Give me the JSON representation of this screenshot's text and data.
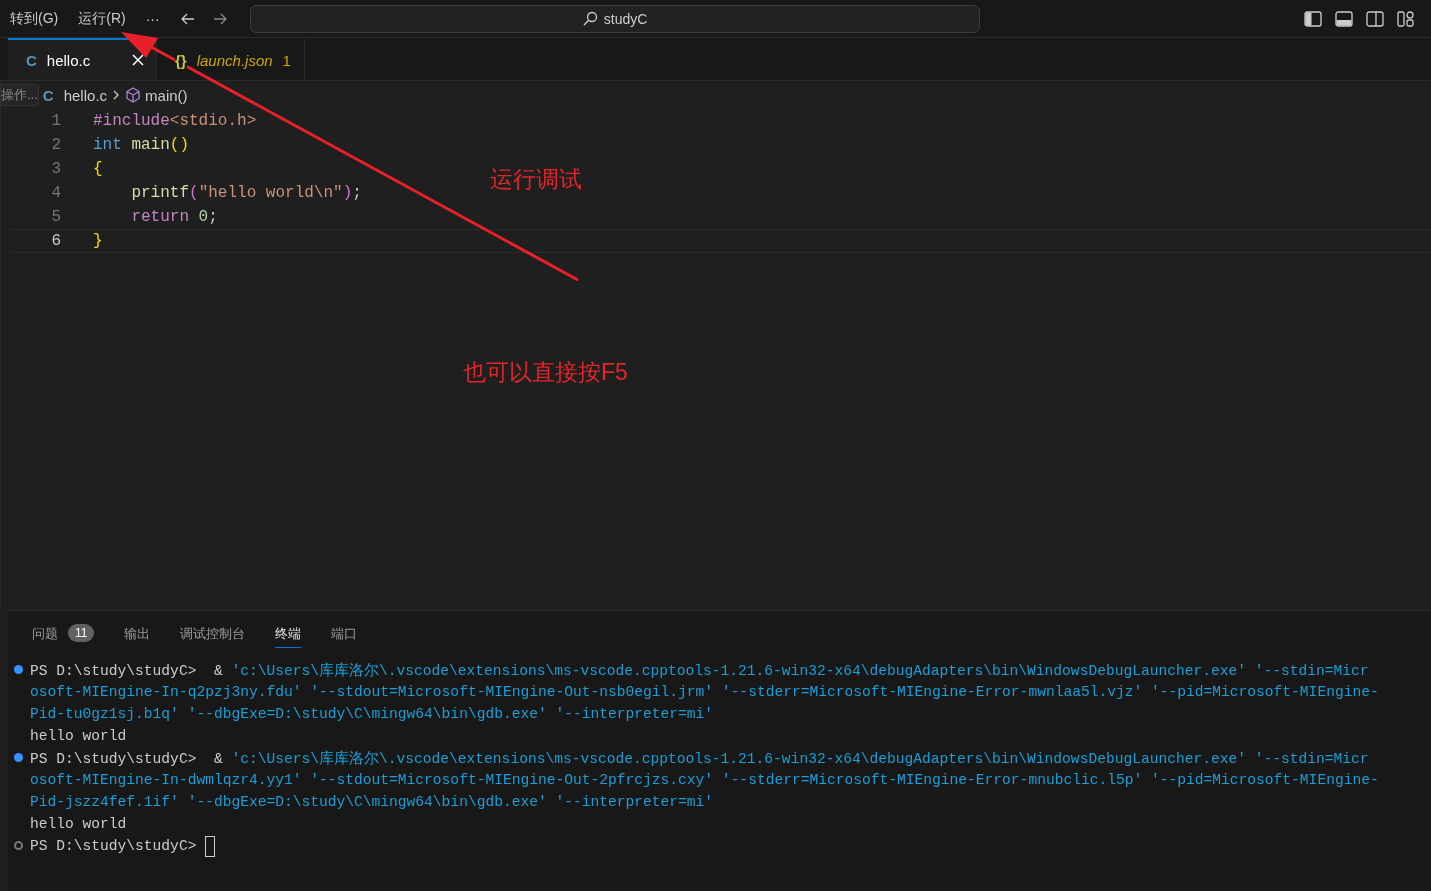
{
  "menu": [
    {
      "label": "转到(G)"
    },
    {
      "label": "运行(R)"
    },
    {
      "label": "···"
    }
  ],
  "search": {
    "value": "studyC"
  },
  "tabs": [
    {
      "icon": "C",
      "kind": "c",
      "label": "hello.c",
      "selected": true
    },
    {
      "icon": "{}",
      "kind": "json",
      "label": "launch.json",
      "count": "1",
      "selected": false
    }
  ],
  "breadcrumb": {
    "hover_hint": "操作...",
    "file_icon": "C",
    "file": "hello.c",
    "symbol": "main()"
  },
  "code": [
    {
      "number": "1",
      "current": false,
      "indent": false,
      "tokens": [
        {
          "kind": "directive",
          "text": "#include"
        },
        {
          "kind": "string",
          "text": "<stdio.h>"
        }
      ]
    },
    {
      "number": "2",
      "current": false,
      "indent": false,
      "tokens": [
        {
          "kind": "keyword",
          "text": "int"
        },
        {
          "kind": "function",
          "text": "main",
          "gap_before": true
        },
        {
          "kind": "bracket",
          "text": "()"
        }
      ]
    },
    {
      "number": "3",
      "current": false,
      "indent": false,
      "tokens": [
        {
          "kind": "bracket",
          "text": "{"
        }
      ]
    },
    {
      "number": "4",
      "current": false,
      "indent": true,
      "tokens": [
        {
          "kind": "function",
          "text": "printf"
        },
        {
          "kind": "bracket2",
          "text": "("
        },
        {
          "kind": "string",
          "text": "\"hello world\\n\""
        },
        {
          "kind": "bracket2",
          "text": ")"
        },
        {
          "kind": "plain",
          "text": ";"
        }
      ]
    },
    {
      "number": "5",
      "current": false,
      "indent": true,
      "tokens": [
        {
          "kind": "directive",
          "text": "return"
        },
        {
          "kind": "number",
          "text": "0",
          "gap_before": true
        },
        {
          "kind": "plain",
          "text": ";"
        }
      ]
    },
    {
      "number": "6",
      "current": true,
      "indent": false,
      "tokens": [
        {
          "kind": "bracket",
          "text": "}"
        }
      ]
    }
  ],
  "annotations": [
    {
      "text": "运行调试"
    },
    {
      "text": "也可以直接按F5"
    }
  ],
  "panel_tabs": [
    {
      "label": "问题",
      "badge": "11",
      "selected": false
    },
    {
      "label": "输出",
      "selected": false
    },
    {
      "label": "调试控制台",
      "selected": false
    },
    {
      "label": "终端",
      "selected": true
    },
    {
      "label": "端口",
      "selected": false
    }
  ],
  "terminal": [
    {
      "success": true,
      "lines": [
        [
          {
            "kind": "prompt",
            "text": "PS D:\\study\\studyC>  & "
          },
          {
            "kind": "arg",
            "text": "'c:\\Users\\库库洛尔\\.vscode\\extensions\\ms-vscode.cpptools-1.21.6-win32-x64\\debugAdapters\\bin\\WindowsDebugLauncher.exe' '--stdin=Micr"
          }
        ],
        [
          {
            "kind": "arg",
            "text": "osoft-MIEngine-In-q2pzj3ny.fdu' '--stdout=Microsoft-MIEngine-Out-nsb0egil.jrm' '--stderr=Microsoft-MIEngine-Error-mwnlaa5l.vjz' '--pid=Microsoft-MIEngine-"
          }
        ],
        [
          {
            "kind": "arg",
            "text": "Pid-tu0gz1sj.b1q' '--dbgExe=D:\\study\\C\\mingw64\\bin\\gdb.exe' '--interpreter=mi'"
          }
        ],
        [
          {
            "kind": "prompt",
            "text": "hello world"
          }
        ]
      ]
    },
    {
      "success": true,
      "lines": [
        [
          {
            "kind": "prompt",
            "text": "PS D:\\study\\studyC>  & "
          },
          {
            "kind": "arg",
            "text": "'c:\\Users\\库库洛尔\\.vscode\\extensions\\ms-vscode.cpptools-1.21.6-win32-x64\\debugAdapters\\bin\\WindowsDebugLauncher.exe' '--stdin=Micr"
          }
        ],
        [
          {
            "kind": "arg",
            "text": "osoft-MIEngine-In-dwmlqzr4.yy1' '--stdout=Microsoft-MIEngine-Out-2pfrcjzs.cxy' '--stderr=Microsoft-MIEngine-Error-mnubclic.l5p' '--pid=Microsoft-MIEngine-"
          }
        ],
        [
          {
            "kind": "arg",
            "text": "Pid-jszz4fef.1if' '--dbgExe=D:\\study\\C\\mingw64\\bin\\gdb.exe' '--interpreter=mi'"
          }
        ],
        [
          {
            "kind": "prompt",
            "text": "hello world"
          }
        ]
      ]
    },
    {
      "success": false,
      "cursor": true,
      "lines": [
        [
          {
            "kind": "prompt",
            "text": "PS D:\\study\\studyC> "
          }
        ]
      ]
    }
  ]
}
